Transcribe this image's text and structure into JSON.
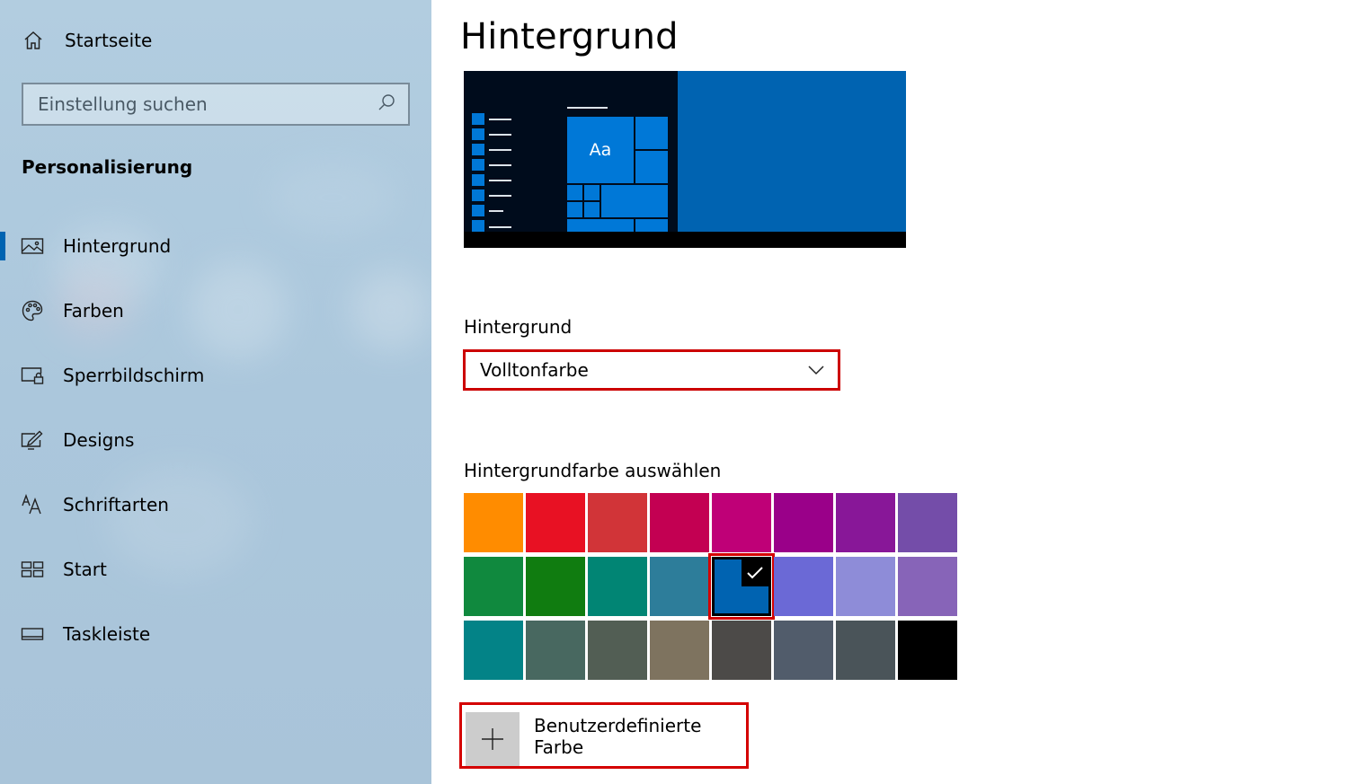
{
  "sidebar": {
    "home_label": "Startseite",
    "search_placeholder": "Einstellung suchen",
    "section_title": "Personalisierung",
    "items": [
      {
        "label": "Hintergrund",
        "icon": "picture-icon",
        "active": true
      },
      {
        "label": "Farben",
        "icon": "palette-icon"
      },
      {
        "label": "Sperrbildschirm",
        "icon": "lock-screen-icon"
      },
      {
        "label": "Designs",
        "icon": "themes-icon"
      },
      {
        "label": "Schriftarten",
        "icon": "fonts-icon"
      },
      {
        "label": "Start",
        "icon": "start-icon"
      },
      {
        "label": "Taskleiste",
        "icon": "taskbar-icon"
      }
    ]
  },
  "main": {
    "title": "Hintergrund",
    "preview": {
      "tile_text": "Aa"
    },
    "background_label": "Hintergrund",
    "background_value": "Volltonfarbe",
    "color_picker_label": "Hintergrundfarbe auswählen",
    "colors": [
      [
        "#ff8c00",
        "#e81123",
        "#d13438",
        "#c30052",
        "#bf0077",
        "#9a0089",
        "#881798",
        "#744da9"
      ],
      [
        "#10893e",
        "#107c10",
        "#018574",
        "#2d7d9a",
        "#0063b1",
        "#6b69d6",
        "#8e8cd8",
        "#8764b8"
      ],
      [
        "#038387",
        "#486860",
        "#525e54",
        "#7e735f",
        "#4c4a48",
        "#515c6b",
        "#4a5459",
        "#000000"
      ]
    ],
    "selected_color": {
      "row": 1,
      "col": 4,
      "hex": "#0063b1"
    },
    "custom_color_label": "Benutzerdefinierte Farbe"
  },
  "colors": {
    "accent": "#0063b1",
    "highlight": "#d40000"
  }
}
